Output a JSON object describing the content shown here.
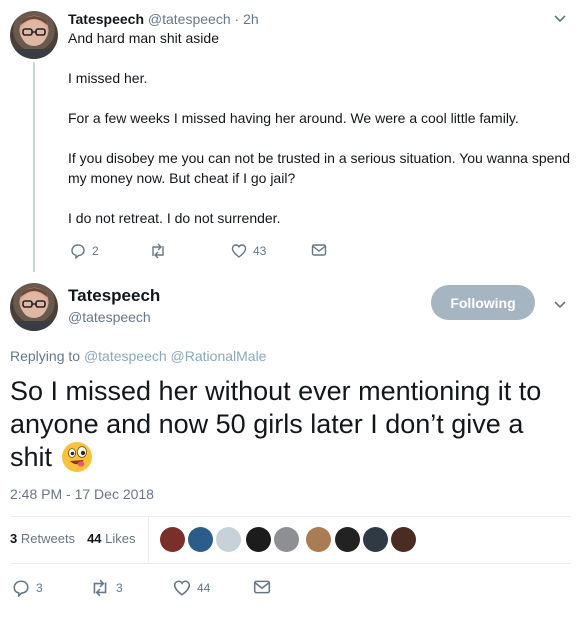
{
  "tweet1": {
    "display_name": "Tatespeech",
    "handle": "@tatespeech",
    "separator": "·",
    "time": "2h",
    "lines": [
      "And hard man shit aside",
      "I missed her.",
      "For a few weeks I missed having her around. We were a cool little family.",
      "If you disobey me you can not be trusted in a serious situation. You wanna spend",
      "my money now. But cheat if I go jail?",
      "I do not retreat. I do not surrender."
    ],
    "replies": "2",
    "retweets": "",
    "likes": "43"
  },
  "tweet2": {
    "display_name": "Tatespeech",
    "handle": "@tatespeech",
    "follow_label": "Following",
    "replying_prefix": "Replying to",
    "replying_to": [
      "@tatespeech",
      "@RationalMale"
    ],
    "text_lines": [
      "So I missed her without ever mentioning it to",
      "anyone and now 50 girls later I don’t give a",
      "shit"
    ],
    "timestamp": "2:48 PM - 17 Dec 2018",
    "retweet_count": "3",
    "retweet_label": "Retweets",
    "like_count": "44",
    "like_label": "Likes",
    "replies": "3",
    "retweets": "3",
    "likes": "44"
  },
  "colors": {
    "accent": "#1da1f2",
    "muted": "#657786",
    "follow_button": "#a5b5c1",
    "emoji": "#f9c23c"
  },
  "icons": {
    "reply": "reply-icon",
    "retweet": "retweet-icon",
    "like": "heart-icon",
    "dm": "envelope-icon",
    "menu": "chevron-down-icon"
  }
}
